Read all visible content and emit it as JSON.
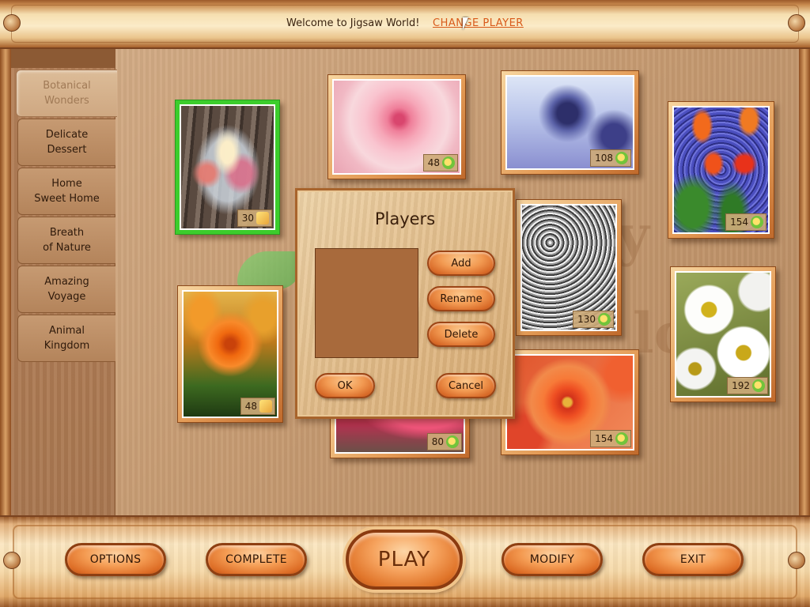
{
  "header": {
    "welcome_text": "Welcome to Jigsaw World!",
    "change_player_label": "CHANGE PLAYER"
  },
  "sidebar": {
    "categories": [
      {
        "label": "Botanical\nWonders",
        "active": true
      },
      {
        "label": "Delicate\nDessert",
        "active": false
      },
      {
        "label": "Home\nSweet Home",
        "active": false
      },
      {
        "label": "Breath\nof Nature",
        "active": false
      },
      {
        "label": "Amazing\nVoyage",
        "active": false
      },
      {
        "label": "Animal\nKingdom",
        "active": false
      }
    ]
  },
  "puzzles": [
    {
      "name": "candles",
      "pieces": "30",
      "icon": "puzzle-piece-icon",
      "selected": true
    },
    {
      "name": "pink-rose",
      "pieces": "48",
      "icon": "rotate-icon"
    },
    {
      "name": "thistle",
      "pieces": "108",
      "icon": "rotate-icon"
    },
    {
      "name": "tulips",
      "pieces": "154",
      "icon": "rotate-icon"
    },
    {
      "name": "orange-rose",
      "pieces": "48",
      "icon": "puzzle-piece-icon"
    },
    {
      "name": "babys-breath",
      "pieces": "130",
      "icon": "rotate-icon"
    },
    {
      "name": "daisies",
      "pieces": "192",
      "icon": "rotate-icon"
    },
    {
      "name": "water-drops",
      "pieces": "80",
      "icon": "rotate-icon"
    },
    {
      "name": "dahlia",
      "pieces": "154",
      "icon": "rotate-icon"
    }
  ],
  "dialog": {
    "title": "Players",
    "add_label": "Add",
    "rename_label": "Rename",
    "delete_label": "Delete",
    "ok_label": "OK",
    "cancel_label": "Cancel"
  },
  "bottom_bar": {
    "options_label": "OPTIONS",
    "complete_label": "COMPLETE",
    "play_label": "PLAY",
    "modify_label": "MODIFY",
    "exit_label": "EXIT"
  },
  "colors": {
    "accent_orange": "#f29a52",
    "link_orange": "#d85a1a",
    "selection_green": "#3ccd2c",
    "wood_light": "#fbe6c0"
  }
}
